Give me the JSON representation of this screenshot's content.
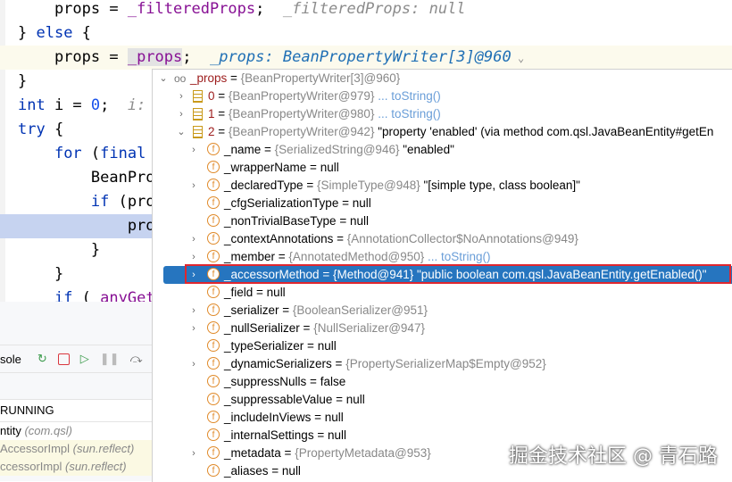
{
  "code": {
    "l1": {
      "a": "    props = ",
      "b": "_filteredProps",
      "c": ";  ",
      "hint": "_filteredProps: null"
    },
    "l2": {
      "a": "} ",
      "kw": "else",
      "b": " {"
    },
    "l3": {
      "a": "    props = ",
      "b": "_props",
      "c": ";  ",
      "hint": "_props: BeanPropertyWriter[3]@960"
    },
    "l4": "}",
    "l5": {
      "kw": "int",
      "a": " i = ",
      "num": "0",
      "b": ";  ",
      "hint": "i:"
    },
    "l6": {
      "kw": "try",
      "a": " {"
    },
    "l7": {
      "a": "    ",
      "kw": "for",
      "b": " (",
      "kw2": "final"
    },
    "l8": "        BeanPro",
    "l9": {
      "a": "        ",
      "kw": "if",
      "b": " (pro"
    },
    "l10": "            pro",
    "l11": "        }",
    "l12": "    }",
    "l13": {
      "a": "    ",
      "kw": "if",
      "b": " ( ",
      "c": "anyGet"
    }
  },
  "debug": {
    "console": "sole",
    "status": "RUNNING",
    "frames": [
      {
        "m": "ntity",
        "p": "(com.qsl)"
      },
      {
        "m": "AccessorImpl",
        "p": "(sun.reflect)"
      },
      {
        "m": "ccessorImpl",
        "p": "(sun.reflect)"
      }
    ]
  },
  "popup": {
    "root": {
      "name": "_props",
      "val": "{BeanPropertyWriter[3]@960}"
    },
    "items": [
      {
        "name": "0",
        "val": "{BeanPropertyWriter@979}",
        "extra": "... toString()"
      },
      {
        "name": "1",
        "val": "{BeanPropertyWriter@980}",
        "extra": "... toString()"
      },
      {
        "name": "2",
        "val": "{BeanPropertyWriter@942}",
        "str": "\"property 'enabled' (via method com.qsl.JavaBeanEntity#getEn"
      }
    ],
    "fields": [
      {
        "name": "_name",
        "val": "{SerializedString@946}",
        "str": "\"enabled\"",
        "exp": true
      },
      {
        "name": "_wrapperName",
        "str": "null"
      },
      {
        "name": "_declaredType",
        "val": "{SimpleType@948}",
        "str": "\"[simple type, class boolean]\"",
        "exp": true
      },
      {
        "name": "_cfgSerializationType",
        "str": "null"
      },
      {
        "name": "_nonTrivialBaseType",
        "str": "null"
      },
      {
        "name": "_contextAnnotations",
        "val": "{AnnotationCollector$NoAnnotations@949}",
        "exp": true
      },
      {
        "name": "_member",
        "val": "{AnnotatedMethod@950}",
        "extra": "... toString()",
        "exp": true
      },
      {
        "name": "_accessorMethod",
        "val": "{Method@941}",
        "str": "\"public boolean com.qsl.JavaBeanEntity.getEnabled()\"",
        "exp": true,
        "selected": true
      },
      {
        "name": "_field",
        "str": "null"
      },
      {
        "name": "_serializer",
        "val": "{BooleanSerializer@951}",
        "exp": true
      },
      {
        "name": "_nullSerializer",
        "val": "{NullSerializer@947}",
        "exp": true
      },
      {
        "name": "_typeSerializer",
        "str": "null"
      },
      {
        "name": "_dynamicSerializers",
        "val": "{PropertySerializerMap$Empty@952}",
        "exp": true
      },
      {
        "name": "_suppressNulls",
        "str": "false"
      },
      {
        "name": "_suppressableValue",
        "str": "null"
      },
      {
        "name": "_includeInViews",
        "str": "null"
      },
      {
        "name": "_internalSettings",
        "str": "null"
      },
      {
        "name": "_metadata",
        "val": "{PropertyMetadata@953}",
        "exp": true
      },
      {
        "name": "_aliases",
        "str": "null"
      }
    ]
  },
  "watermark": "掘金技术社区 @ 青石路"
}
